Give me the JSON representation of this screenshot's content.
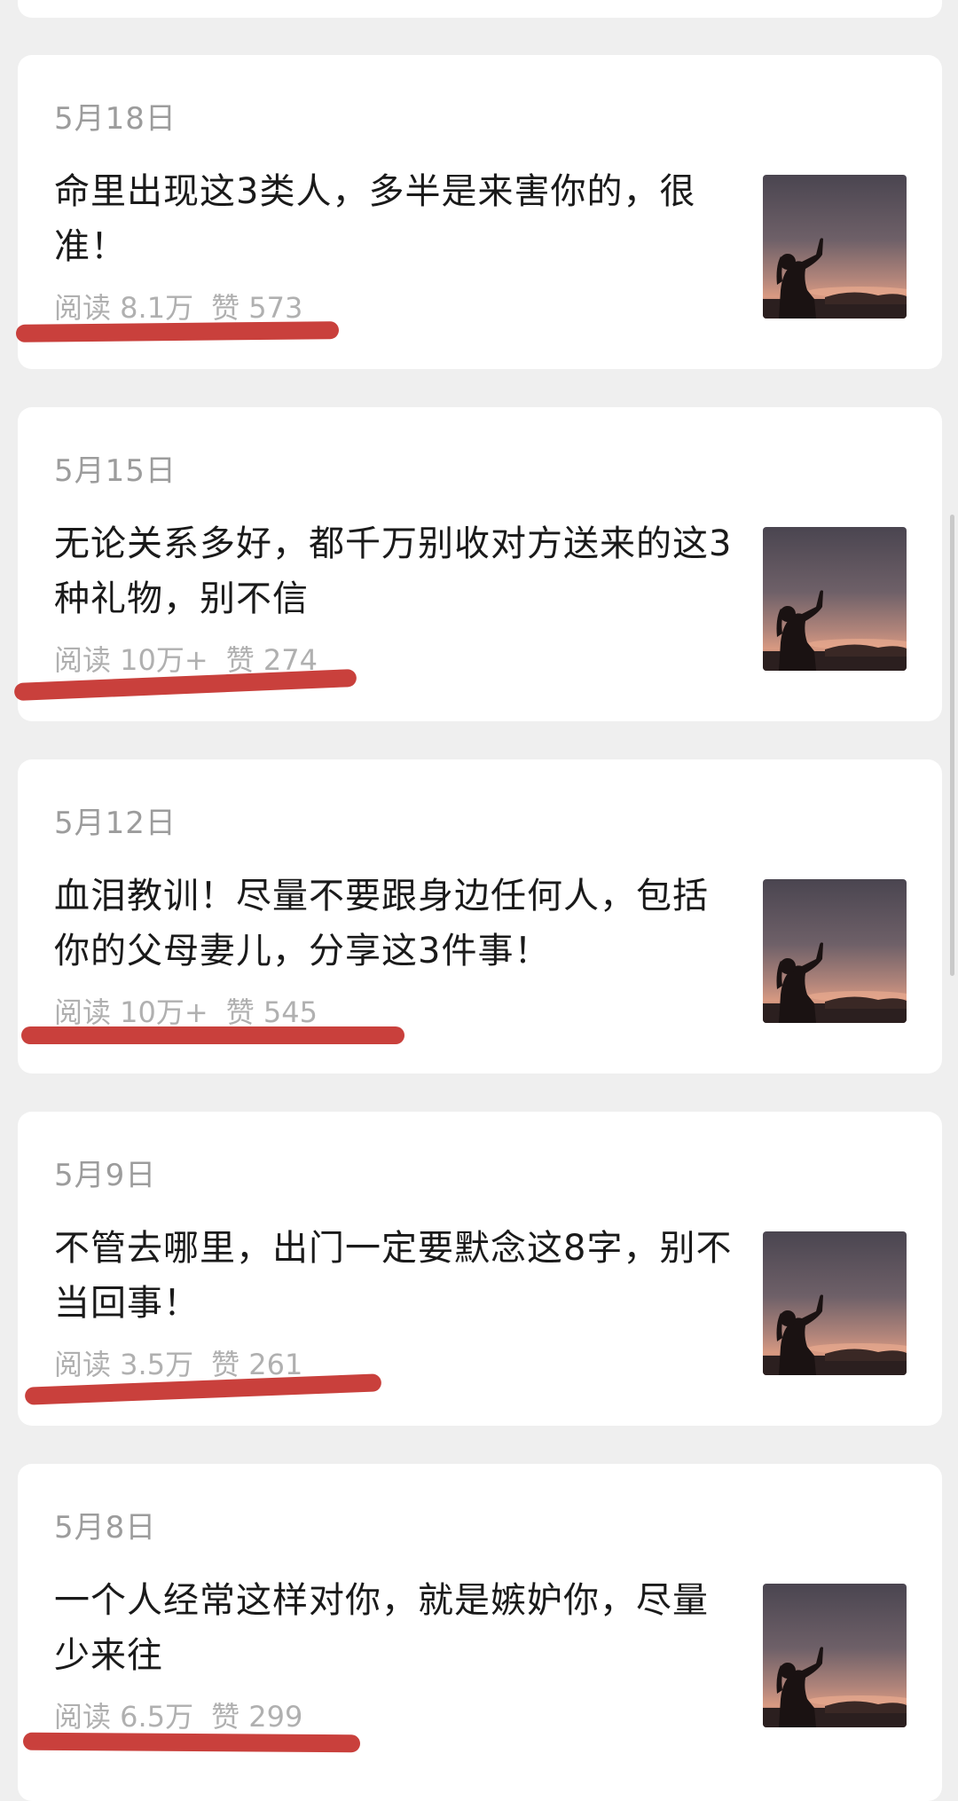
{
  "articles": [
    {
      "date": "5月18日",
      "title": "命里出现这3类人，多半是来害你的，很准！",
      "reads": "阅读 8.1万",
      "likes": "赞 573"
    },
    {
      "date": "5月15日",
      "title": "无论关系多好，都千万别收对方送来的这3种礼物，别不信",
      "reads": "阅读 10万+",
      "likes": "赞 274"
    },
    {
      "date": "5月12日",
      "title": "血泪教训！尽量不要跟身边任何人，包括你的父母妻儿，分享这3件事！",
      "reads": "阅读 10万+",
      "likes": "赞 545"
    },
    {
      "date": "5月9日",
      "title": "不管去哪里，出门一定要默念这8字，别不当回事！",
      "reads": "阅读 3.5万",
      "likes": "赞 261"
    },
    {
      "date": "5月8日",
      "title": "一个人经常这样对你，就是嫉妒你，尽量少来往",
      "reads": "阅读 6.5万",
      "likes": "赞 299"
    }
  ],
  "colors": {
    "background": "#efefef",
    "card": "#ffffff",
    "underline": "#c4302b"
  },
  "icons": {
    "thumbnail": "sunset-silhouette-image"
  }
}
